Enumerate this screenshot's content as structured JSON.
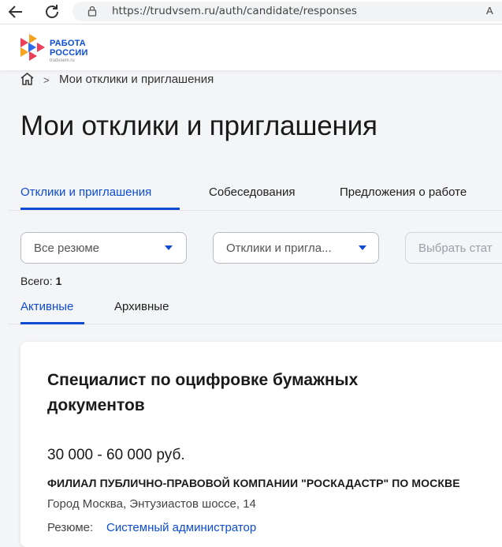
{
  "browser": {
    "url": "https://trudvsem.ru/auth/candidate/responses",
    "right_icon_text": "A"
  },
  "site": {
    "logo_line1": "РАБОТА",
    "logo_line2": "РОССИИ",
    "logo_line3": "trudvsem.ru"
  },
  "breadcrumb": {
    "separator": ">",
    "current": "Мои отклики и приглашения"
  },
  "page": {
    "title": "Мои отклики и приглашения"
  },
  "tabs": [
    {
      "label": "Отклики и приглашения",
      "active": true
    },
    {
      "label": "Собеседования",
      "active": false
    },
    {
      "label": "Предложения о работе",
      "active": false
    }
  ],
  "filters": {
    "resume_select": "Все резюме",
    "type_select": "Отклики и пригла...",
    "status_select": "Выбрать стат"
  },
  "total": {
    "label": "Всего:",
    "count": "1"
  },
  "subtabs": [
    {
      "label": "Активные",
      "active": true
    },
    {
      "label": "Архивные",
      "active": false
    }
  ],
  "card": {
    "title": "Специалист по оцифровке бумажных документов",
    "salary": "30 000 - 60 000 руб.",
    "company": "ФИЛИАЛ ПУБЛИЧНО-ПРАВОВОЙ КОМПАНИИ \"РОСКАДАСТР\" ПО МОСКВЕ",
    "address": "Город Москва, Энтузиастов шоссе, 14",
    "resume_label": "Резюме:",
    "resume_value": "Системный администратор"
  },
  "colors": {
    "accent": "#0d4cd3",
    "logo_red": "#ee3f58",
    "logo_orange": "#f7a121"
  }
}
